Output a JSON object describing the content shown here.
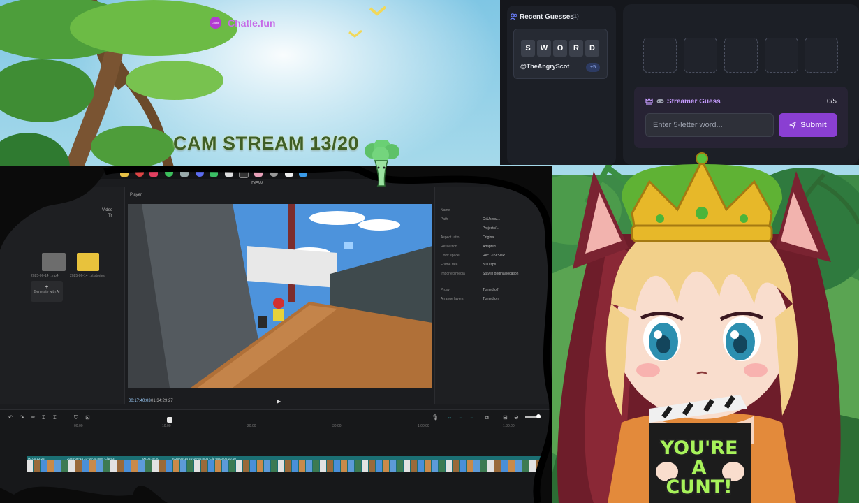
{
  "stream": {
    "title": "CAM STREAM 13/20"
  },
  "editor": {
    "window_title": "DEW",
    "asset_tabs": [
      "Video",
      "Tr"
    ],
    "asset_items": [
      {
        "caption": "2025-06-14 ..mp4",
        "icon": "video-thumbnail"
      },
      {
        "caption": "2025-06-14 ..st stories",
        "icon": "folder-icon"
      }
    ],
    "generate_label": "Generate with AI",
    "player_label": "Player",
    "timecode": "00:17:40:03",
    "duration": "01:34:29:27",
    "details": [
      {
        "key": "Name",
        "value": ""
      },
      {
        "key": "Path",
        "value": "C:/Users/..."
      },
      {
        "key": "",
        "value": "Projects/..."
      },
      {
        "key": "Aspect ratio",
        "value": "Original"
      },
      {
        "key": "Resolution",
        "value": "Adapted"
      },
      {
        "key": "Color space",
        "value": "Rec. 709 SDR"
      },
      {
        "key": "Frame rate",
        "value": "30.00fps"
      },
      {
        "key": "Imported media",
        "value": "Stay in original location"
      },
      {
        "key": "Proxy",
        "value": "Turned off"
      },
      {
        "key": "Arrange layers",
        "value": "Turned on"
      }
    ],
    "ruler": [
      "00:00",
      "10:00",
      "20:00",
      "30:00",
      "1:00:00",
      "1:30:00"
    ],
    "clips": [
      {
        "label": "00:00:12:22"
      },
      {
        "label": "2025-06-14 21-16-30.mp4 Clip 63"
      },
      {
        "label": "00:00:20:20"
      },
      {
        "label": "2025-06-14 21-16-30.mp4 Clip 65"
      },
      {
        "label": "00:00:20:10"
      }
    ]
  },
  "widget": {
    "recent_title": "Recent Guesses",
    "recent_count": "(1)",
    "guess": {
      "letters": [
        "S",
        "W",
        "O",
        "R",
        "D"
      ],
      "user": "@TheAngryScot",
      "bonus": "+5"
    },
    "brand_name": "Chatle.fun",
    "brand_logo_text": "Chatle",
    "slots": 5,
    "streamer_title": "Streamer Guess",
    "streamer_count": "0/5",
    "input_placeholder": "Enter 5-letter word...",
    "submit_label": "Submit"
  },
  "vtuber": {
    "sign": [
      "YOU'RE",
      "A",
      "CUNT!"
    ]
  },
  "colors": {
    "accent": "#8a3fd2",
    "brand": "#c66be7",
    "sign": "#a7f25a",
    "stream_title": "#3f5f26"
  }
}
